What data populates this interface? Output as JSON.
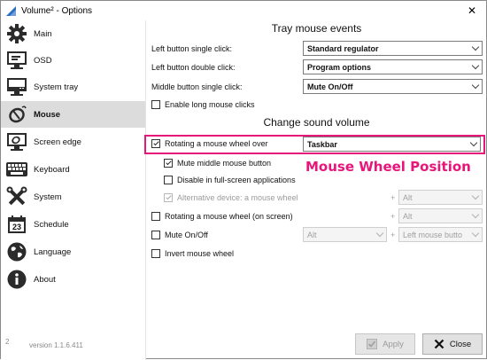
{
  "window": {
    "title": "Volume² - Options",
    "close_glyph": "✕"
  },
  "sidebar": {
    "items": [
      {
        "label": "Main",
        "icon": "gear-icon"
      },
      {
        "label": "OSD",
        "icon": "monitor-icon"
      },
      {
        "label": "System tray",
        "icon": "tray-icon"
      },
      {
        "label": "Mouse",
        "icon": "mouse-icon",
        "active": true
      },
      {
        "label": "Screen edge",
        "icon": "screen-edge-icon"
      },
      {
        "label": "Keyboard",
        "icon": "keyboard-icon"
      },
      {
        "label": "System",
        "icon": "tools-icon"
      },
      {
        "label": "Schedule",
        "icon": "calendar-icon",
        "calendar_day": "23"
      },
      {
        "label": "Language",
        "icon": "globe-icon"
      },
      {
        "label": "About",
        "icon": "info-icon"
      }
    ]
  },
  "tray_section": {
    "title": "Tray mouse events",
    "left_single_label": "Left button single click:",
    "left_single_value": "Standard regulator",
    "left_double_label": "Left button double click:",
    "left_double_value": "Program options",
    "middle_single_label": "Middle button single click:",
    "middle_single_value": "Mute On/Off",
    "enable_long_label": "Enable long mouse clicks"
  },
  "sound_section": {
    "title": "Change sound volume",
    "rotating_over_label": "Rotating a mouse wheel over",
    "rotating_over_value": "Taskbar",
    "mute_middle_label": "Mute middle mouse button",
    "disable_fullscreen_label": "Disable in full-screen applications",
    "alt_device_label": "Alternative device: a mouse wheel",
    "alt_device_value": "Alt",
    "rotating_screen_label": "Rotating a mouse wheel (on screen)",
    "rotating_screen_value": "Alt",
    "mute_onoff_label": "Mute On/Off",
    "mute_onoff_mod": "Alt",
    "mute_onoff_button": "Left mouse butto",
    "invert_label": "Invert mouse wheel",
    "plus": "+"
  },
  "annotation": {
    "text": "Mouse Wheel Position",
    "color": "#e8157a"
  },
  "footer": {
    "version": "version 1.1.6.411",
    "corner_logo": "2",
    "apply_label": "Apply",
    "close_label": "Close"
  }
}
